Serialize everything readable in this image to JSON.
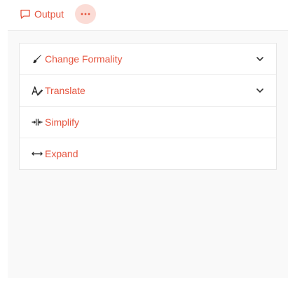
{
  "header": {
    "output_tab_label": "Output",
    "output_icon": "comment-icon",
    "more_icon": "ellipsis-icon"
  },
  "menu": {
    "items": [
      {
        "label": "Change Formality",
        "icon": "brush-icon",
        "has_submenu": true
      },
      {
        "label": "Translate",
        "icon": "translate-icon",
        "has_submenu": true
      },
      {
        "label": "Simplify",
        "icon": "compress-icon",
        "has_submenu": false
      },
      {
        "label": "Expand",
        "icon": "expand-arrows-icon",
        "has_submenu": false
      }
    ]
  },
  "colors": {
    "accent": "#e5533d",
    "more_button_bg": "#fbdcd6",
    "panel_bg": "#f9f9f9"
  }
}
